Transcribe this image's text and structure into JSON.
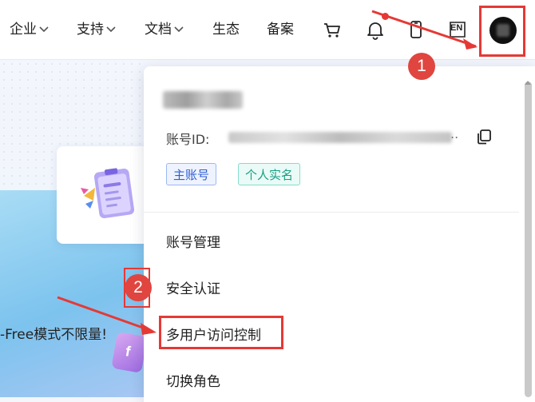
{
  "nav": {
    "items": [
      {
        "label": "企业",
        "has_dropdown": true
      },
      {
        "label": "支持",
        "has_dropdown": true
      },
      {
        "label": "文档",
        "has_dropdown": true
      },
      {
        "label": "生态",
        "has_dropdown": false
      },
      {
        "label": "备案",
        "has_dropdown": false
      }
    ],
    "icons": [
      "cart-icon",
      "bell-icon",
      "phone-icon",
      "language-icon",
      "avatar"
    ],
    "lang_label": "EN"
  },
  "dropdown": {
    "account_id_label": "账号ID:",
    "account_id_ellipsis": "..",
    "badges": [
      "主账号",
      "个人实名"
    ],
    "menu": [
      "账号管理",
      "安全认证",
      "多用户访问控制",
      "切换角色"
    ]
  },
  "background": {
    "promo_text": "-Free模式不限量!",
    "card_icon": "f"
  },
  "annotations": {
    "step1": "1",
    "step2": "2"
  },
  "colors": {
    "annotation_red": "#e53935",
    "badge_blue": "#2f5fd0",
    "badge_green": "#159f84"
  }
}
